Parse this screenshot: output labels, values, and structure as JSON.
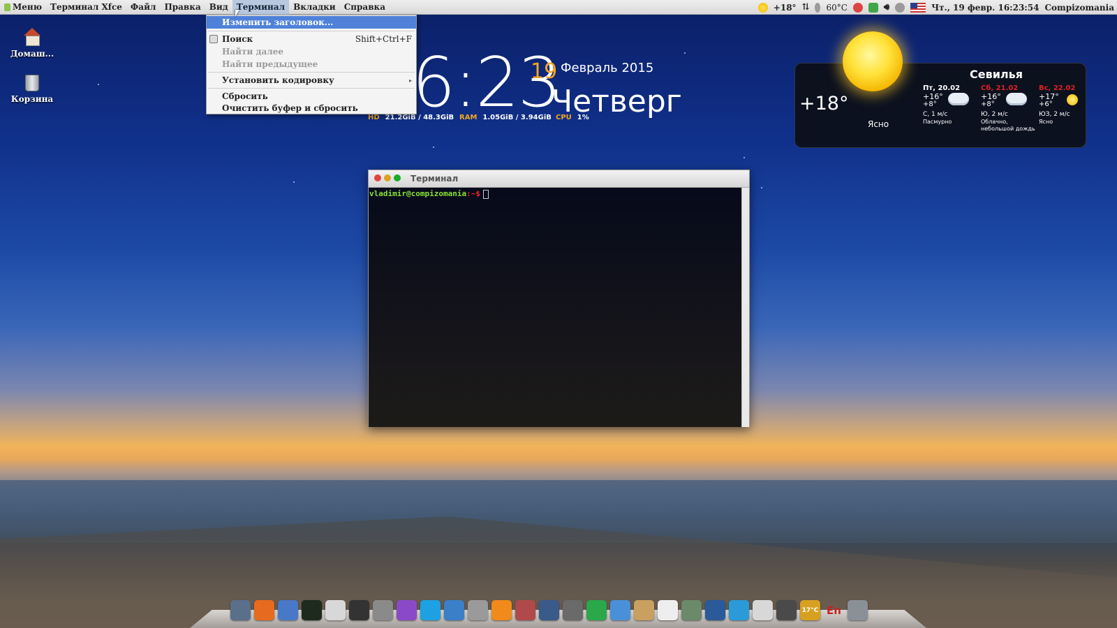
{
  "panel": {
    "app_menu": "Меню",
    "menus": [
      "Терминал Xfce",
      "Файл",
      "Правка",
      "Вид",
      "Терминал",
      "Вкладки",
      "Справка"
    ],
    "active_menu": "Терминал",
    "tray": {
      "weather_temp": "+18°",
      "cpu_temp": "60°C",
      "datetime": "Чт., 19 февр. 16:23:54",
      "user": "Compizomania"
    }
  },
  "dropdown": {
    "items": [
      {
        "label": "Изменить заголовок...",
        "shortcut": "",
        "state": "highlighted"
      },
      {
        "label": "Поиск",
        "shortcut": "Shift+Ctrl+F",
        "state": "enabled"
      },
      {
        "label": "Найти далее",
        "shortcut": "",
        "state": "disabled"
      },
      {
        "label": "Найти предыдущее",
        "shortcut": "",
        "state": "disabled"
      },
      {
        "label": "Установить кодировку",
        "shortcut": "",
        "state": "submenu"
      },
      {
        "label": "Сбросить",
        "shortcut": "",
        "state": "enabled"
      },
      {
        "label": "Очистить буфер и сбросить",
        "shortcut": "",
        "state": "enabled"
      }
    ],
    "submenu_arrow": "▸"
  },
  "desktop": {
    "icons": [
      {
        "label": "Домаш...",
        "icon": "home-folder-icon"
      },
      {
        "label": "Корзина",
        "icon": "trash-icon"
      }
    ]
  },
  "clock": {
    "time": "6:23",
    "day": "19",
    "month_year": "Февраль 2015",
    "weekday": "Четверг",
    "hd_label": "HD",
    "hd_value": "21.2GiB / 48.3GiB",
    "ram_label": "RAM",
    "ram_value": "1.05GiB / 3.94GiB",
    "cpu_label": "CPU",
    "cpu_value": "1%"
  },
  "weather": {
    "temp": "+18°",
    "condition": "Ясно",
    "city": "Севилья",
    "forecast": [
      {
        "day": "Пт, 20.02",
        "high": "+16°",
        "low": "+8°",
        "wind": "С, 1 м/с",
        "cond": "Пасмурно",
        "weekend": false,
        "icon": "cloud-icon"
      },
      {
        "day": "Сб, 21.02",
        "high": "+16°",
        "low": "+8°",
        "wind": "Ю, 2 м/с",
        "cond": "Облачно, небольшой дождь",
        "weekend": true,
        "icon": "rain-cloud-icon"
      },
      {
        "day": "Вс, 22.02",
        "high": "+17°",
        "low": "+6°",
        "wind": "ЮЗ, 2 м/с",
        "cond": "Ясно",
        "weekend": true,
        "icon": "sun-icon"
      }
    ]
  },
  "terminal": {
    "title": "Терминал",
    "prompt_user": "vladimir@compizomania",
    "prompt_path": ":~$"
  },
  "dock": {
    "items": [
      {
        "name": "app-switcher-icon",
        "color": "#5a6f8a"
      },
      {
        "name": "firefox-icon",
        "color": "#e66a1f"
      },
      {
        "name": "file-manager-icon",
        "color": "#4a78c8"
      },
      {
        "name": "terminal-icon",
        "color": "#1e2a1e"
      },
      {
        "name": "text-editor-icon",
        "color": "#d8d8d8"
      },
      {
        "name": "camera-icon",
        "color": "#333333"
      },
      {
        "name": "calculator-icon",
        "color": "#8a8a8a"
      },
      {
        "name": "graphics-icon",
        "color": "#8a4ac8"
      },
      {
        "name": "skype-icon",
        "color": "#1da1e2"
      },
      {
        "name": "libreoffice-icon",
        "color": "#3a7fc8"
      },
      {
        "name": "music-player-icon",
        "color": "#9a9a9a"
      },
      {
        "name": "vlc-icon",
        "color": "#f08a1a"
      },
      {
        "name": "package-installer-icon",
        "color": "#b04a4a"
      },
      {
        "name": "steam-icon",
        "color": "#3a5a8a"
      },
      {
        "name": "settings-icon",
        "color": "#6a6a6a"
      },
      {
        "name": "update-manager-icon",
        "color": "#2aa84a"
      },
      {
        "name": "documents-icon",
        "color": "#4a90d8"
      },
      {
        "name": "archive-icon",
        "color": "#c8a060"
      },
      {
        "name": "cards-game-icon",
        "color": "#eeeeee"
      },
      {
        "name": "remote-desktop-icon",
        "color": "#6a8a6a"
      },
      {
        "name": "virtualbox-icon",
        "color": "#2a5a9a"
      },
      {
        "name": "tv-icon",
        "color": "#2a9ad8"
      },
      {
        "name": "image-viewer-icon",
        "color": "#d8d8d8"
      },
      {
        "name": "power-icon",
        "color": "#4a4a4a"
      },
      {
        "name": "weather-dock-icon",
        "color": "#d8a020"
      },
      {
        "name": "keyboard-layout-icon",
        "color": "#c82020"
      },
      {
        "name": "dock-trash-icon",
        "color": "#8a9098"
      }
    ],
    "weather_badge": "17°C",
    "layout_label": "En"
  }
}
